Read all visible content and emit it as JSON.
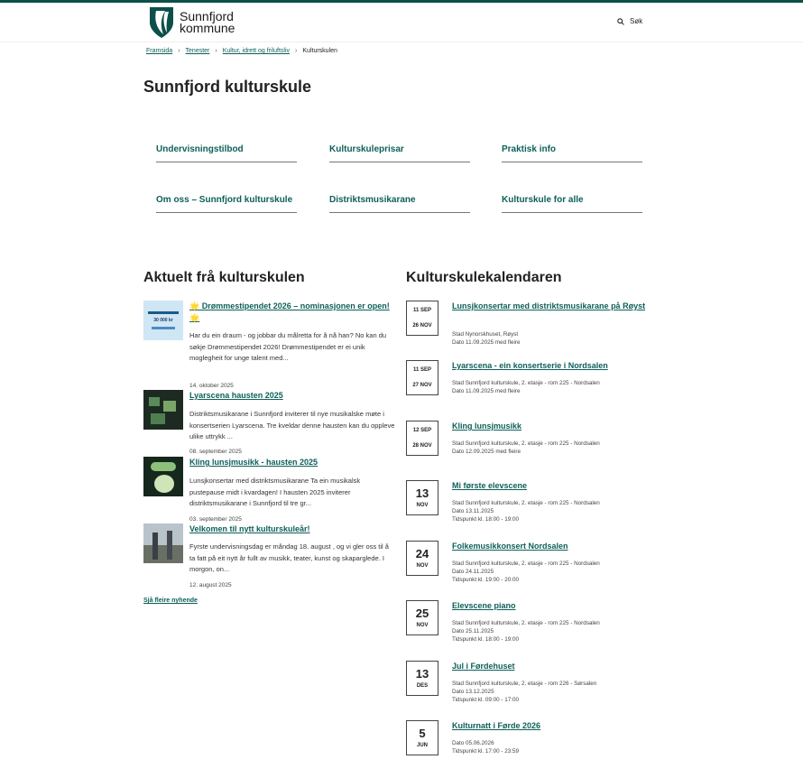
{
  "header": {
    "logo_line1": "Sunnfjord",
    "logo_line2": "kommune",
    "search_label": "Søk"
  },
  "breadcrumb": {
    "items": [
      "Framsida",
      "Tenester",
      "Kultur, idrett og friluftsliv"
    ],
    "current": "Kulturskulen"
  },
  "page_title": "Sunnfjord kulturskule",
  "nav_cards": [
    "Undervisningstilbod",
    "Kulturskuleprisar",
    "Praktisk info",
    "Om oss – Sunnfjord kulturskule",
    "Distriktsmusikarane",
    "Kulturskule for alle"
  ],
  "news": {
    "title": "Aktuelt frå kulturskulen",
    "items": [
      {
        "title": "🌟 Drømmestipendet 2026 – nominasjonen er open! 🌟",
        "text": "Har du ein draum - og jobbar du målretta for å nå han? No kan du søkje Drømmestipendet 2026! Drømmestipendet er ei unik moglegheit for unge talent med...",
        "date": "14. oktober 2025",
        "thumb_text": "30 000 kr"
      },
      {
        "title": "Lyarscena hausten 2025",
        "text": "Distriktsmusikarane i Sunnfjord inviterer til nye musikalske møte i konsertserien Lyarscena. Tre kveldar denne hausten kan du oppleve ulike uttrykk ...",
        "date": "08. september 2025"
      },
      {
        "title": "Kling lunsjmusikk - hausten 2025",
        "text": "Lunsjkonsertar med distriktsmusikarane Ta ein musikalsk pustepause midt i kvardagen! I hausten 2025 inviterer distriktsmusikarane i Sunnfjord til tre gr...",
        "date": "03. september 2025"
      },
      {
        "title": "Velkomen til nytt kulturskuleår!",
        "text": "Fyrste undervisningsdag er måndag 18. august , og vi gler oss til å ta fatt på eit nytt år fullt av musikk, teater, kunst og skaparglede. I morgon, on...",
        "date": "12. august 2025"
      }
    ],
    "more_link": "Sjå fleire nyhende"
  },
  "calendar": {
    "title": "Kulturskulekalendaren",
    "events": [
      {
        "d1": "11 SEP",
        "d2": "26 NOV",
        "title": "Lunsjkonsertar med distriktsmusikarane på Røyst",
        "meta": [
          "Stad Nynorskhuset, Røyst",
          "Dato 11.09.2025 med fleire"
        ]
      },
      {
        "d1": "11 SEP",
        "d2": "27 NOV",
        "title": "Lyarscena - ein konsertserie i Nordsalen",
        "meta": [
          "Stad Sunnfjord kulturskule, 2. etasje - rom 225 - Nordsalen",
          "Dato 11.09.2025 med fleire"
        ]
      },
      {
        "d1": "12 SEP",
        "d2": "28 NOV",
        "title": "Kling lunsjmusikk",
        "meta": [
          "Stad Sunnfjord kulturskule, 2. etasje - rom 225 - Nordsalen",
          "Dato 12.09.2025 med fleire"
        ]
      },
      {
        "day": "13",
        "mon": "NOV",
        "title": "Mi første elevscene",
        "meta": [
          "Stad Sunnfjord kulturskule, 2. etasje - rom 225 - Nordsalen",
          "Dato 13.11.2025",
          "Tidspunkt kl. 18:00 - 19:00"
        ]
      },
      {
        "day": "24",
        "mon": "NOV",
        "title": "Folkemusikkonsert Nordsalen",
        "meta": [
          "Stad Sunnfjord kulturskule, 2. etasje - rom 225 - Nordsalen",
          "Dato 24.11.2025",
          "Tidspunkt kl. 19:00 - 20:00"
        ]
      },
      {
        "day": "25",
        "mon": "NOV",
        "title": "Elevscene piano",
        "meta": [
          "Stad Sunnfjord kulturskule, 2. etasje - rom 225 - Nordsalen",
          "Dato 25.11.2025",
          "Tidspunkt kl. 18:00 - 19:00"
        ]
      },
      {
        "day": "13",
        "mon": "DES",
        "title": "Jul i Førdehuset",
        "meta": [
          "Stad Sunnfjord kulturskule, 2. etasje - rom 226 - Sørsalen",
          "Dato 13.12.2025",
          "Tidspunkt kl. 09:00 - 17:00"
        ]
      },
      {
        "day": "5",
        "mon": "JUN",
        "title": "Kulturnatt i Førde 2026",
        "meta": [
          "Dato 05.06.2026",
          "Tidspunkt kl. 17:00 - 23:59"
        ]
      }
    ]
  },
  "colors": {
    "brand": "#0d4f4a",
    "link": "#0d5f59"
  }
}
